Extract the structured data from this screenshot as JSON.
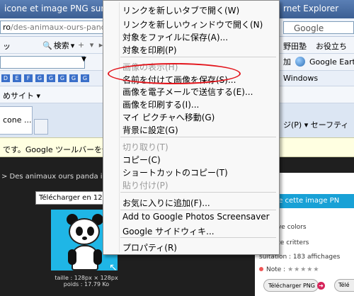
{
  "browser": {
    "title_left": "icone et image PNG sur icone",
    "title_right": "rnet Explorer",
    "address_host": "ro",
    "address_path": "/des-animaux-ours-panda",
    "address_right": "Google",
    "toolbar1_partial": "ッ",
    "search_label": "検索",
    "toolbar1_misc": "+ ▾ ▸ ▾ ▾",
    "toolbar1_right_1": "野田塾",
    "toolbar1_right_2": "お役立ち",
    "toolbar2_right_partial": "加",
    "google_earth_label": "Google Earth",
    "toolbar3_icons": [
      "D",
      "E",
      "F",
      "G",
      "G",
      "G",
      "G",
      "G"
    ],
    "toolbar3_right": "Windows",
    "favorites_label": "めサイト ▾",
    "tab_label": "cone ...",
    "tab_right": "ジ(P) ▾  セーフティ",
    "infobar_text": "です。Google ツールバーを使用して翻訳"
  },
  "page": {
    "breadcrumb": "> Des animaux ours panda icone",
    "tooltip": "Télécharger en 128px",
    "thumb_size": "taille : 128px × 128px",
    "thumb_weight": "poids : 17.79 Ko",
    "panel_title": "pos de cette image PN",
    "author": "r : I love colors",
    "collection": "e : Cute critters",
    "views": "sultation : 183 affichages",
    "note_label": "Note :",
    "stars": "★★★★★",
    "download_png": "Télécharger PNG",
    "download_other": "Télé"
  },
  "context_menu": {
    "items": [
      {
        "label": "リンクを新しいタブで開く(W)",
        "enabled": true
      },
      {
        "label": "リンクを新しいウィンドウで開く(N)",
        "enabled": true
      },
      {
        "label": "対象をファイルに保存(A)...",
        "enabled": true
      },
      {
        "label": "対象を印刷(P)",
        "enabled": true
      },
      {
        "label": "画像の表示(H)",
        "enabled": false
      },
      {
        "label": "名前を付けて画像を保存(S)...",
        "enabled": true
      },
      {
        "label": "画像を電子メールで送信する(E)...",
        "enabled": true
      },
      {
        "label": "画像を印刷する(I)...",
        "enabled": true
      },
      {
        "label": "マイ ピクチャへ移動(G)",
        "enabled": true
      },
      {
        "label": "背景に設定(G)",
        "enabled": true
      },
      {
        "label": "切り取り(T)",
        "enabled": false
      },
      {
        "label": "コピー(C)",
        "enabled": true
      },
      {
        "label": "ショートカットのコピー(T)",
        "enabled": true
      },
      {
        "label": "貼り付け(P)",
        "enabled": false
      },
      {
        "label": "お気に入りに追加(F)...",
        "enabled": true
      },
      {
        "label": "Add to Google Photos Screensaver",
        "enabled": true
      },
      {
        "label": "Google サイドウィキ...",
        "enabled": true
      },
      {
        "label": "プロパティ(R)",
        "enabled": true
      }
    ],
    "highlighted_item_index": 5,
    "highlight_color": "#e3141b"
  }
}
